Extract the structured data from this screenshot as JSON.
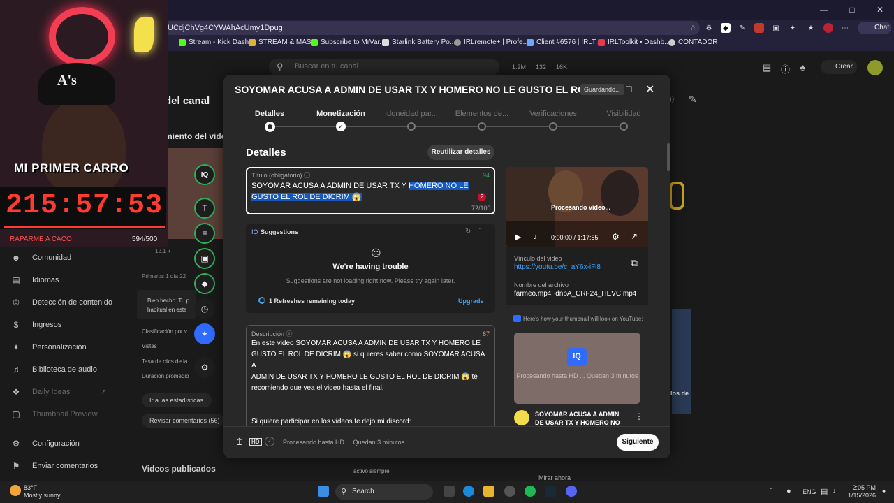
{
  "browser": {
    "url": "/UCdjChVg4CYWAhAcUmy1Dpug",
    "copilot_label": "Chat",
    "bookmarks": [
      "Stream - Kick Dash...",
      "STREAM & MAS",
      "Subscribe to MrVar...",
      "Starlink Battery Po...",
      "IRLremote+ | Profe...",
      "Client #6576 | IRLT...",
      "IRLToolkit • Dashb...",
      "CONTADOR"
    ]
  },
  "studio": {
    "search_placeholder": "Buscar en tu canal",
    "stats": [
      "1.2M",
      "132",
      "16K"
    ],
    "create_label": "Crear",
    "channel_heading": "del canal",
    "subheading": "miento del video",
    "nav": [
      "Comunidad",
      "Idiomas",
      "Detección de contenido",
      "Ingresos",
      "Personalización",
      "Biblioteca de audio",
      "Daily Ideas",
      "Thumbnail Preview",
      "Configuración",
      "Enviar comentarios"
    ],
    "bg_items": [
      "Primeros 1 día 22",
      "Bien hecho. Tu p",
      "habitual en este",
      "Clasificación por v",
      "Vistas",
      "Tasa de clics de la",
      "Duración promedio",
      "Ir a las estadísticas",
      "Revisar comentarios (56)",
      "Videos publicados",
      "Mirar ahora",
      "activo siempre",
      "12.1 k",
      "los de"
    ]
  },
  "cam": {
    "sign": "MI PRIMER CARRO",
    "timer": "215:57:53",
    "caption": "RAPARME A CACO",
    "count": "594/500",
    "cap_logo": "A's"
  },
  "modal": {
    "title": "SOYOMAR ACUSA A ADMIN DE USAR TX Y HOMERO NO LE GUSTO EL RO...",
    "saving": "Guardando...",
    "steps": [
      "Detalles",
      "Monetización",
      "Idoneidad par...",
      "Elementos de...",
      "Verificaciones",
      "Visibilidad"
    ],
    "heading": "Detalles",
    "reuse_label": "Reutilizar detalles",
    "title_field": {
      "label": "Título (obligatorio)",
      "score": "94",
      "text_plain": "SOYOMAR ACUSA A ADMIN DE USAR TX Y ",
      "text_selected": "HOMERO NO LE GUSTO EL ROL DE DICRIM 😱",
      "badge": "2",
      "count": "72/100"
    },
    "suggestions": {
      "iq": "IQ",
      "title": "Suggestions",
      "trouble": "We're having trouble",
      "sub": "Suggestions are not loading right now. Please try again later.",
      "refreshes": "1 Refreshes remaining today",
      "upgrade": "Upgrade"
    },
    "description": {
      "label": "Descripción",
      "score": "67",
      "text": "En este video SOYOMAR ACUSA A ADMIN DE USAR TX Y HOMERO LE\nGUSTO EL ROL DE DICRIM 😱 si quieres saber como SOYOMAR ACUSA A\nADMIN DE USAR TX Y HOMERO LE GUSTO EL ROL DE DICRIM 😱 te\nrecomiendo que vea el video hasta el final.\n\n\nSi quiere participar en los videos te dejo mi discord:\nhttps://discord.gg/farmeord"
    },
    "video": {
      "processing": "Procesando video...",
      "time": "0:00:00 / 1:17:55",
      "link_label": "Vínculo del video",
      "link": "https://youtu.be/c_aY6x-iFi8",
      "file_label": "Nombre del archivo",
      "file": "farmeo.mp4~dnpA_CRF24_HEVC.mp4"
    },
    "thumb": {
      "note": "Here's how your thumbnail will look on YouTube:",
      "processing": "Procesando hasta HD ... Quedan 3 minutos",
      "card_title": "SOYOMAR ACUSA A ADMIN DE USAR TX Y HOMERO NO LE"
    },
    "footer": {
      "processing": "Procesando hasta HD ... Quedan 3 minutos",
      "next": "Siguiente"
    }
  },
  "taskbar": {
    "temp": "83°F",
    "weather": "Mostly sunny",
    "search": "Search",
    "lang": "ENG",
    "time": "2:05 PM",
    "date": "1/15/2026"
  }
}
